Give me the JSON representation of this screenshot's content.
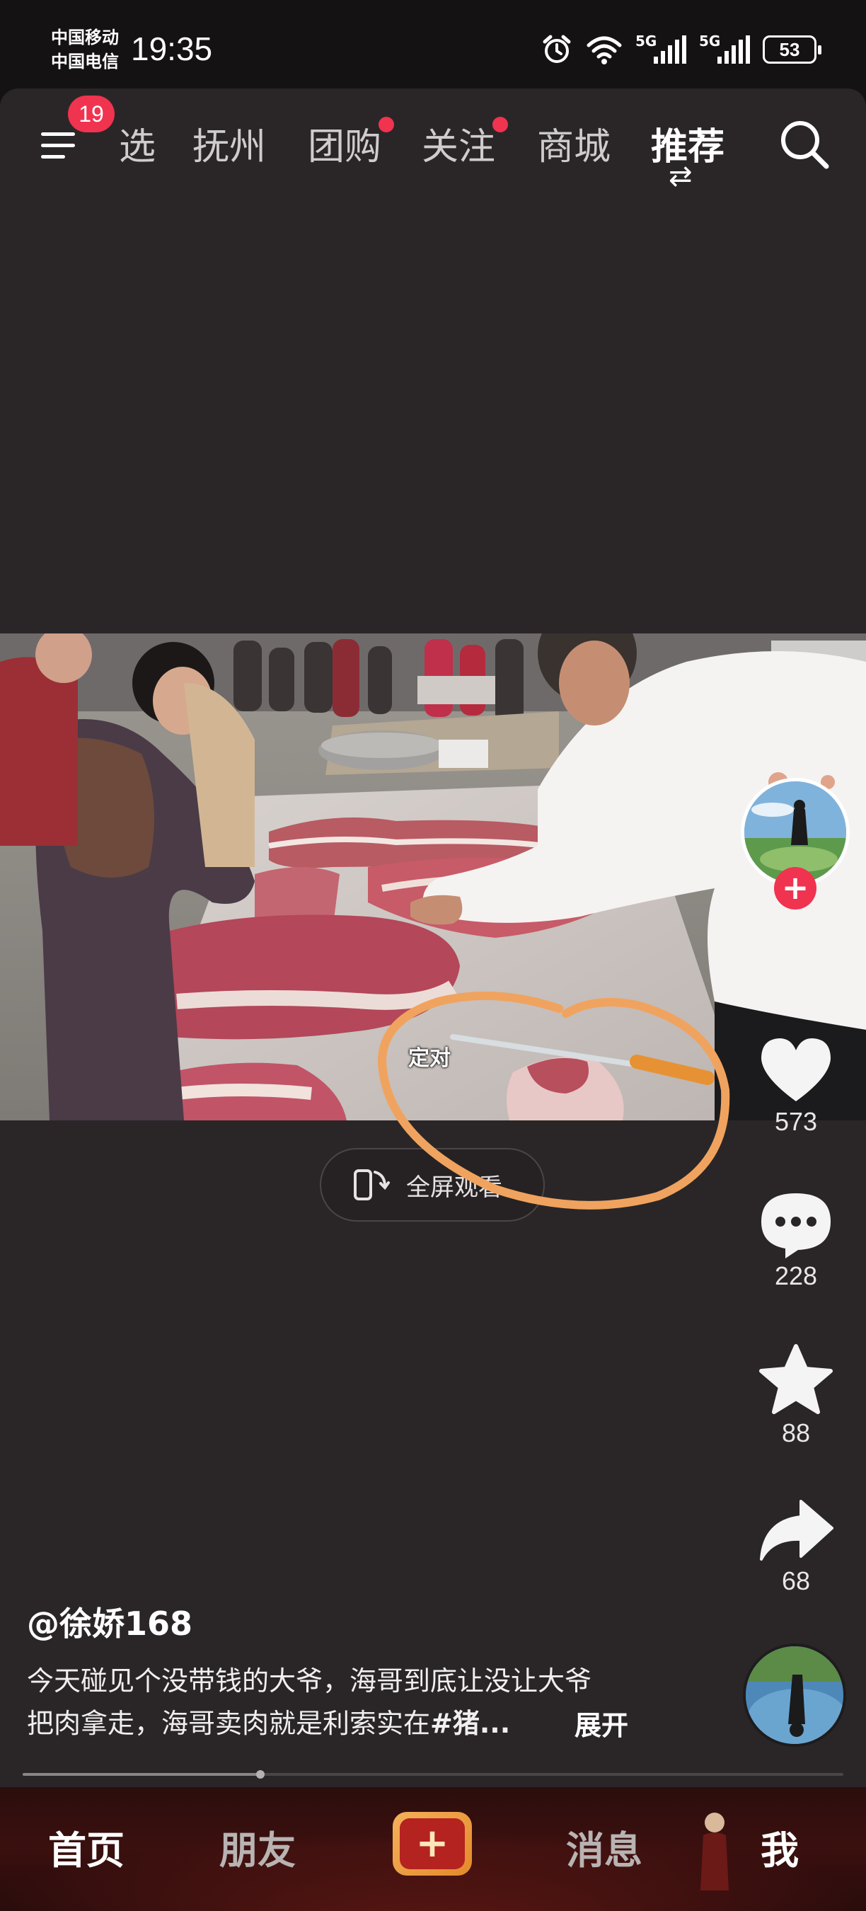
{
  "status_bar": {
    "carrier_1": "中国移动",
    "carrier_2": "中国电信",
    "time": "19:35",
    "sim1_label": "5G",
    "sim2_label": "5G",
    "battery": "53"
  },
  "top_nav": {
    "menu_badge": "19",
    "tabs": [
      {
        "label": "选",
        "active": false
      },
      {
        "label": "抚州",
        "active": false
      },
      {
        "label": "团购",
        "active": false,
        "dot": true
      },
      {
        "label": "关注",
        "active": false,
        "dot": true
      },
      {
        "label": "商城",
        "active": false
      },
      {
        "label": "推荐",
        "active": true
      }
    ],
    "swap_mark": "⇄"
  },
  "video": {
    "overlay_text": "定对",
    "fullscreen_label": "全屏观看"
  },
  "actions": {
    "likes": "573",
    "comments": "228",
    "favorites": "88",
    "shares": "68"
  },
  "caption": {
    "author": "@徐娇168",
    "line1": "今天碰见个没带钱的大爷，海哥到底让没让大爷",
    "line2_text": "把肉拿走，海哥卖肉就是利索实在",
    "line2_tag": "#猪...",
    "expand": "展开"
  },
  "progress": {
    "fraction": 0.29
  },
  "bottom_nav": {
    "home": "首页",
    "friends": "朋友",
    "plus": "+",
    "messages": "消息",
    "me": "我"
  },
  "colors": {
    "accent_red": "#f0334f",
    "annotation_orange": "#f0a35e",
    "panel_bg": "#2a2628"
  }
}
